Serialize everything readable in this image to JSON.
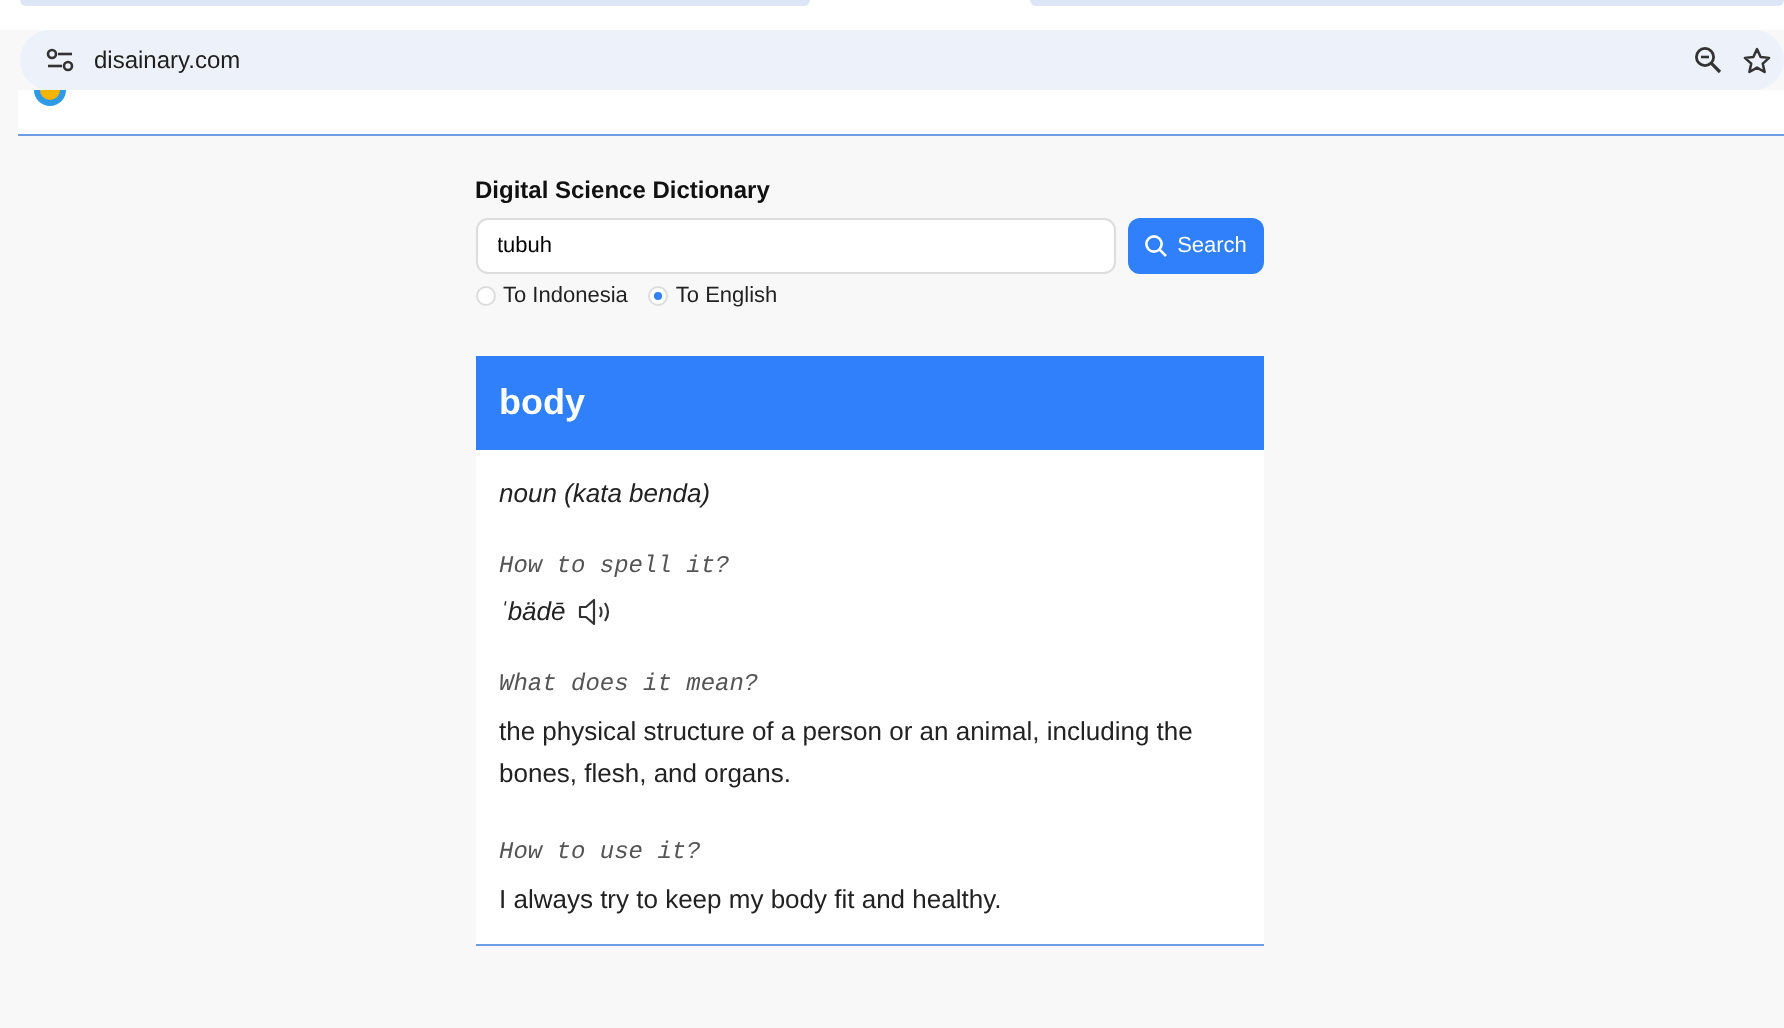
{
  "browser": {
    "url": "disainary.com"
  },
  "search": {
    "title": "Digital Science Dictionary",
    "value": "tubuh",
    "button": "Search"
  },
  "directions": [
    {
      "label": "To Indonesia",
      "selected": false
    },
    {
      "label": "To English",
      "selected": true
    }
  ],
  "entry": {
    "word": "body",
    "part_of_speech": "noun (kata benda)",
    "sections": [
      {
        "kind": "pronunciation",
        "heading": "How to spell it?",
        "text": "ˈbädē"
      },
      {
        "kind": "text",
        "heading": "What does it mean?",
        "text": "the physical structure of a person or an animal, including the bones, flesh, and organs."
      },
      {
        "kind": "text",
        "heading": "How to use it?",
        "text": "I always try to keep my body fit and healthy."
      }
    ]
  }
}
